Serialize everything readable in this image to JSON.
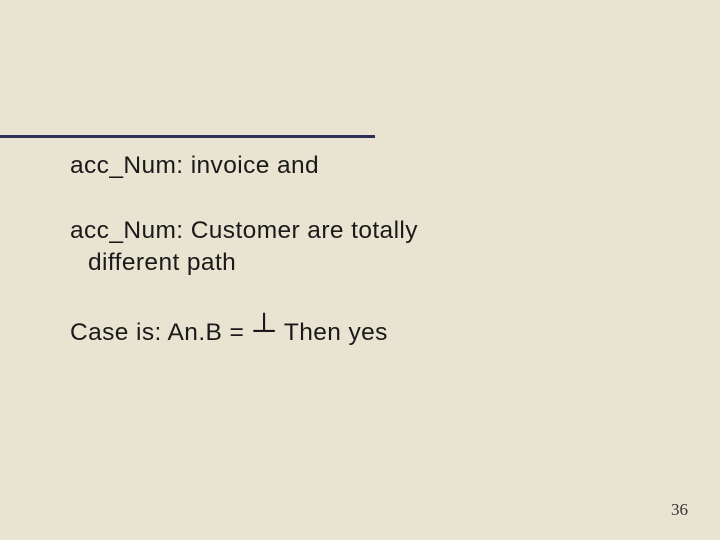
{
  "slide": {
    "line1": "acc_Num: invoice  and",
    "line2a": "acc_Num: Customer are  totally",
    "line2b": "different path",
    "line3_prefix": "Case is:  An.B = ",
    "line3_symbol": "┴",
    "line3_suffix": "  Then yes",
    "page_number": "36"
  }
}
